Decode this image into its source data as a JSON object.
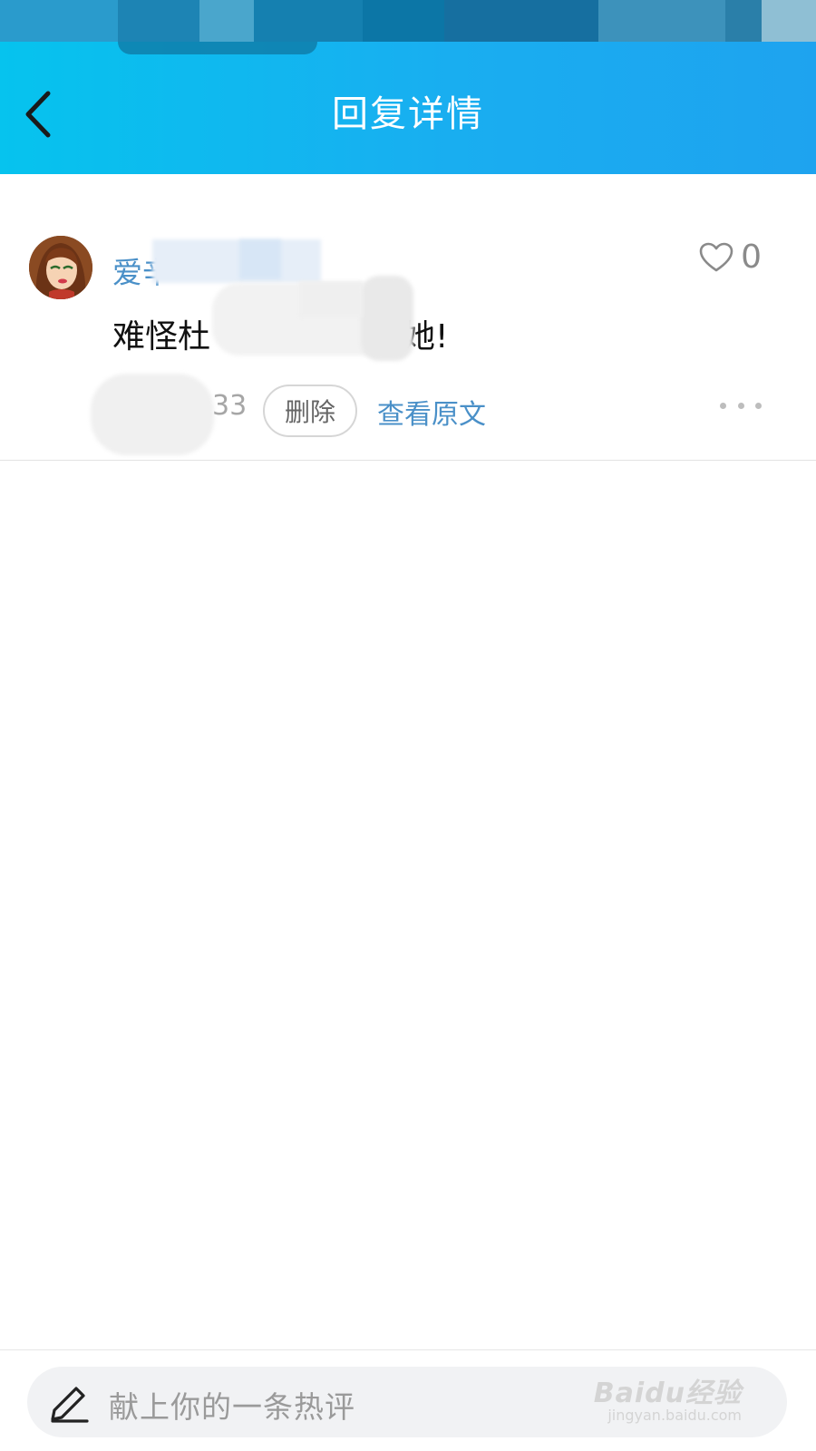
{
  "header": {
    "title": "回复详情",
    "back_icon": "chevron-left-icon"
  },
  "reply": {
    "username_visible": "爱辛",
    "like_count": "0",
    "text_start": "难怪杜",
    "text_end": "她!",
    "time_fragment": "33",
    "delete_label": "删除",
    "view_original_label": "查看原文"
  },
  "comment_bar": {
    "placeholder": "献上你的一条热评",
    "watermark_main": "Baidu经验",
    "watermark_sub": "jingyan.baidu.com"
  },
  "colors": {
    "header_gradient_start": "#06c3ee",
    "header_gradient_end": "#1ea3ef",
    "link_blue": "#4a90c8",
    "text_dark": "#111111",
    "muted_gray": "#9a9a9a"
  }
}
